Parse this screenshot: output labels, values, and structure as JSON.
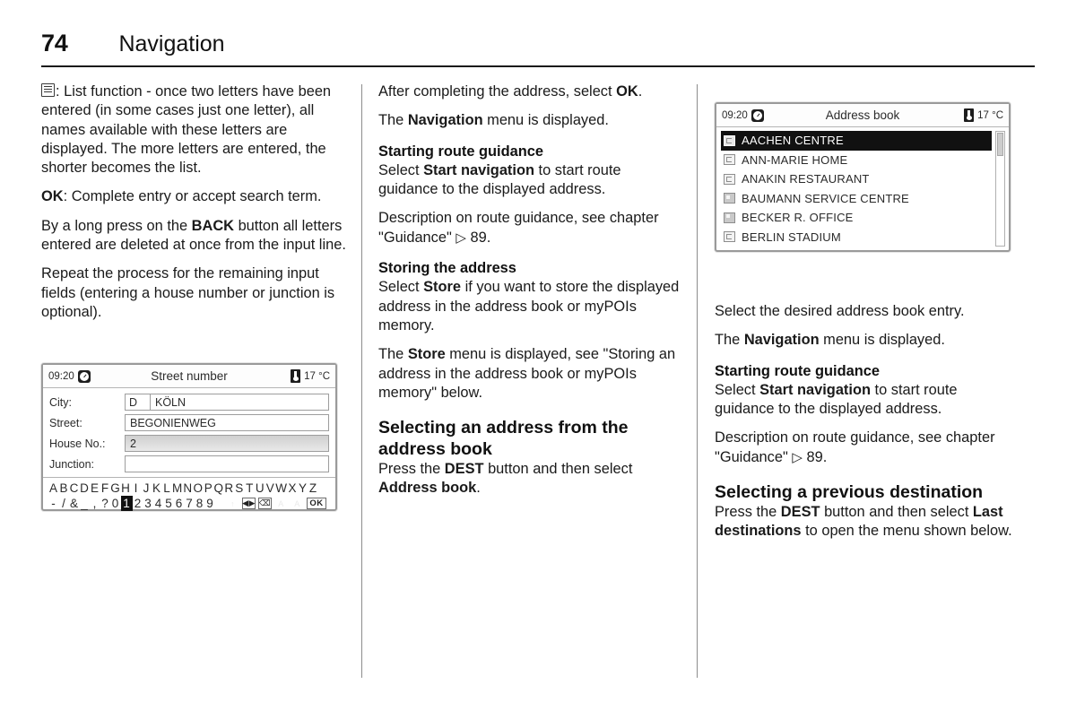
{
  "header": {
    "page_number": "74",
    "title": "Navigation"
  },
  "column1": {
    "list_icon_name": "list-icon",
    "para_list_function": ": List function - once two letters have been entered (in some cases just one letter), all names available with these letters are displayed. The more letters are entered, the shorter becomes the list.",
    "ok_label": "OK",
    "para_ok": ": Complete entry or accept search term.",
    "para_back_pre": "By a long press on the ",
    "back_label": "BACK",
    "para_back_post": " button all letters entered are deleted at once from the input line.",
    "para_repeat": "Repeat the process for the remaining input fields (entering a house number or junction is optional)."
  },
  "street_number_screen": {
    "status": {
      "time": "09:20",
      "title": "Street number",
      "temperature": "17 °C",
      "clock_icon": "clock-icon",
      "temp_icon": "thermometer-icon"
    },
    "fields": [
      {
        "label": "City:",
        "country": "D",
        "value": "KÖLN",
        "selected": false
      },
      {
        "label": "Street:",
        "country": "",
        "value": "BEGONIENWEG",
        "selected": false
      },
      {
        "label": "House No.:",
        "country": "",
        "value": "2",
        "selected": true
      },
      {
        "label": "Junction:",
        "country": "",
        "value": "",
        "selected": false
      }
    ],
    "keyboard": {
      "letters": [
        "A",
        "B",
        "C",
        "D",
        "E",
        "F",
        "G",
        "H",
        "I",
        "J",
        "K",
        "L",
        "M",
        "N",
        "O",
        "P",
        "Q",
        "R",
        "S",
        "T",
        "U",
        "V",
        "W",
        "X",
        "Y",
        "Z"
      ],
      "symbols": [
        "-",
        "/",
        "&",
        "_",
        ",",
        "?",
        "0",
        "1",
        "2",
        "3",
        "4",
        "5",
        "6",
        "7",
        "8",
        "9"
      ],
      "highlighted": "1",
      "action_keys": [
        {
          "name": "shift-up-icon",
          "glyph": "↑",
          "state": "faded",
          "boxed": false
        },
        {
          "name": "cursor-left-right-icon",
          "glyph": "◀▶",
          "state": "normal",
          "boxed": true
        },
        {
          "name": "backspace-icon",
          "glyph": "⌫",
          "state": "normal",
          "boxed": true
        },
        {
          "name": "letters-a-icon",
          "glyph": "A",
          "state": "faded",
          "boxed": false
        },
        {
          "name": "letters-a-alt-icon",
          "glyph": "A",
          "state": "faded",
          "boxed": false
        },
        {
          "name": "ok-key",
          "glyph": "OK",
          "state": "normal",
          "boxed": true
        }
      ]
    }
  },
  "column2": {
    "para_after_complete_pre": "After completing the address, select ",
    "ok_label": "OK",
    "para_after_complete_post": ".",
    "para_nav_menu_pre": "The ",
    "nav_label": "Navigation",
    "para_nav_menu_post": " menu is displayed.",
    "heading_starting_route": "Starting route guidance",
    "para_select_start_pre": "Select ",
    "start_nav_label": "Start navigation",
    "para_select_start_post": " to start route guidance to the displayed address.",
    "para_description_pre": "Description on route guidance, see chapter \"Guidance\" ",
    "arrow_glyph": "▷",
    "para_description_page": " 89.",
    "heading_storing": "Storing the address",
    "para_store_pre": "Select ",
    "store_label": "Store",
    "para_store_post": " if you want to store the displayed address in the address book or myPOIs memory.",
    "para_store_menu_pre": "The ",
    "store_label2": "Store",
    "para_store_menu_post": " menu is displayed, see \"Storing an address in the address book or myPOIs memory\" below.",
    "heading_selecting_address": "Selecting an address from the address book",
    "para_press_dest_pre": "Press the ",
    "dest_label": "DEST",
    "para_press_dest_mid": " button and then select ",
    "address_book_label": "Address book",
    "para_press_dest_post": "."
  },
  "address_book_screen": {
    "status": {
      "time": "09:20",
      "title": "Address book",
      "temperature": "17 °C",
      "clock_icon": "clock-icon",
      "temp_icon": "thermometer-icon"
    },
    "entries": [
      {
        "label": "AACHEN CENTRE",
        "icon": "home-entry-icon",
        "selected": true
      },
      {
        "label": "ANN-MARIE HOME",
        "icon": "home-entry-icon",
        "selected": false
      },
      {
        "label": "ANAKIN RESTAURANT",
        "icon": "home-entry-icon",
        "selected": false
      },
      {
        "label": "BAUMANN SERVICE CENTRE",
        "icon": "office-entry-icon",
        "selected": false
      },
      {
        "label": "BECKER R. OFFICE",
        "icon": "office-entry-icon",
        "selected": false
      },
      {
        "label": "BERLIN STADIUM",
        "icon": "home-entry-icon",
        "selected": false
      }
    ],
    "scrollbar": "vertical-scrollbar"
  },
  "column3": {
    "para_select_entry": "Select the desired address book entry.",
    "para_nav_menu_pre": "The ",
    "nav_label": "Navigation",
    "para_nav_menu_post": " menu is displayed.",
    "heading_starting_route": "Starting route guidance",
    "para_select_start_pre": "Select ",
    "start_nav_label": "Start navigation",
    "para_select_start_post": " to start route guidance to the displayed address.",
    "para_description_pre": "Description on route guidance, see chapter \"Guidance\" ",
    "arrow_glyph": "▷",
    "para_description_page": " 89.",
    "heading_previous_destination": "Selecting a previous destination",
    "para_press_dest_pre": "Press the ",
    "dest_label": "DEST",
    "para_press_dest_mid": " button and then select ",
    "last_dest_label": "Last destinations",
    "para_press_dest_post": " to open the menu shown below."
  }
}
